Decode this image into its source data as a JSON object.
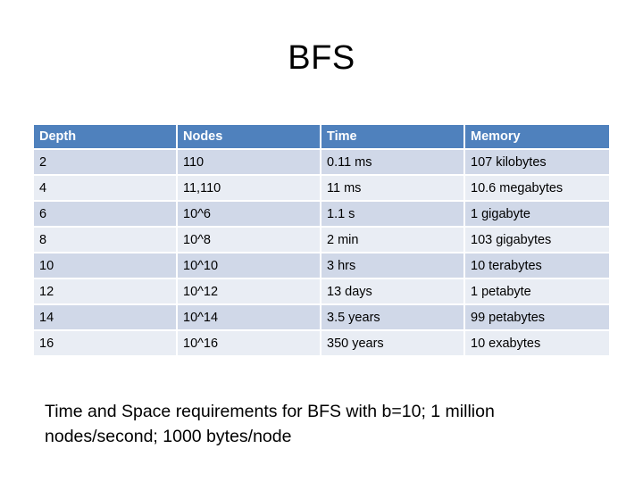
{
  "slide": {
    "title": "BFS",
    "caption": "Time and Space requirements for BFS with b=10; 1 million nodes/second; 1000 bytes/node"
  },
  "colors": {
    "header_bg": "#4f81bd",
    "header_text": "#ffffff",
    "row_dark": "#d0d8e8",
    "row_light": "#e9edf4"
  },
  "table": {
    "headers": [
      "Depth",
      "Nodes",
      "Time",
      "Memory"
    ],
    "rows": [
      [
        "2",
        "110",
        "0.11 ms",
        "107 kilobytes"
      ],
      [
        "4",
        "11,110",
        "11 ms",
        "10.6 megabytes"
      ],
      [
        "6",
        "10^6",
        "1.1 s",
        "1 gigabyte"
      ],
      [
        "8",
        "10^8",
        "2 min",
        "103 gigabytes"
      ],
      [
        "10",
        "10^10",
        "3 hrs",
        "10 terabytes"
      ],
      [
        "12",
        "10^12",
        "13 days",
        "1 petabyte"
      ],
      [
        "14",
        "10^14",
        "3.5 years",
        "99 petabytes"
      ],
      [
        "16",
        "10^16",
        "350 years",
        "10 exabytes"
      ]
    ]
  }
}
